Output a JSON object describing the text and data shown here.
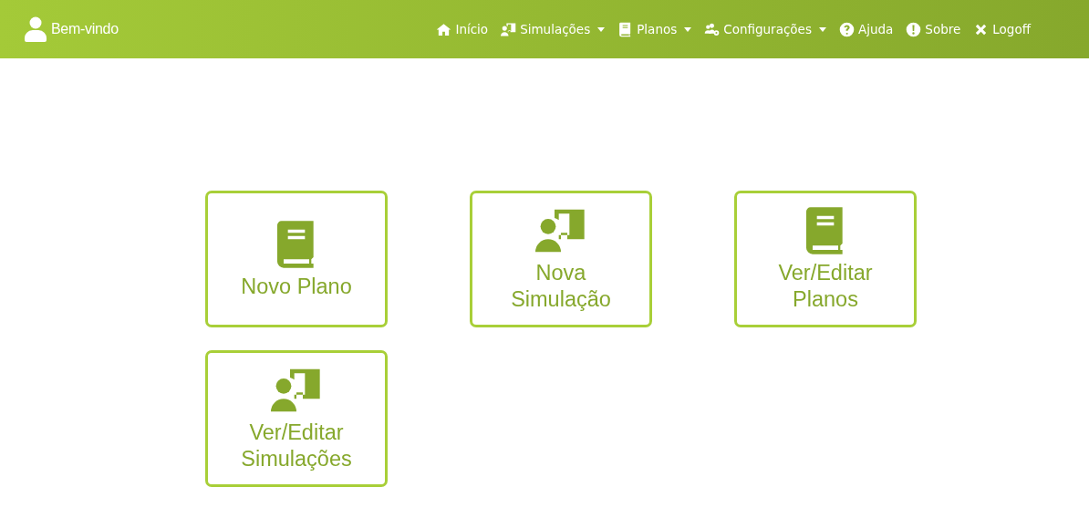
{
  "brand": {
    "label": "Bem-vindo"
  },
  "nav": [
    {
      "label": "Início",
      "kind": "home",
      "dropdown": false
    },
    {
      "label": "Simulações",
      "kind": "presentation",
      "dropdown": true
    },
    {
      "label": "Planos",
      "kind": "book",
      "dropdown": true
    },
    {
      "label": "Configurações",
      "kind": "settings",
      "dropdown": true
    },
    {
      "label": "Ajuda",
      "kind": "help",
      "dropdown": false
    },
    {
      "label": "Sobre",
      "kind": "about",
      "dropdown": false
    },
    {
      "label": "Logoff",
      "kind": "logoff",
      "dropdown": false
    }
  ],
  "tiles": [
    {
      "label": "Novo Plano",
      "kind": "book"
    },
    {
      "label": "Nova Simulação",
      "kind": "presentation"
    },
    {
      "label": "Ver/Editar Planos",
      "kind": "book"
    },
    {
      "label": "Ver/Editar Simulações",
      "kind": "presentation"
    }
  ]
}
